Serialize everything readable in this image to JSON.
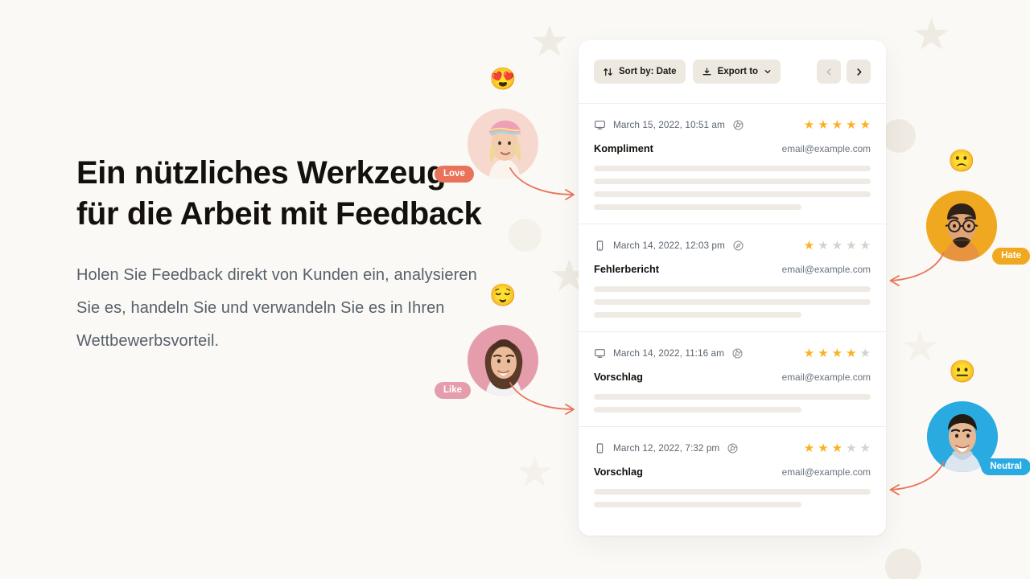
{
  "page": {
    "background_color": "#FBF9F5",
    "accent_color": "#FDB022",
    "arrow_color": "#E8735A"
  },
  "hero": {
    "heading": "Ein nützliches Werkzeug für die Arbeit mit Feedback",
    "paragraph": "Holen Sie Feedback direkt von Kunden ein, analysieren Sie es, handeln Sie und verwandeln Sie es in Ihren Wettbewerbsvorteil."
  },
  "card": {
    "toolbar": {
      "sort_label": "Sort by: Date",
      "sort_icon": "sort-arrows-icon",
      "export_label": "Export to",
      "export_icon": "download-icon",
      "export_chevron_icon": "chevron-down-icon",
      "prev_label": "‹",
      "prev_icon": "chevron-left-icon",
      "next_label": "›",
      "next_icon": "chevron-right-icon"
    },
    "rows": [
      {
        "device_icon": "desktop-icon",
        "date": "March 15, 2022, 10:51 am",
        "browser_icon": "chrome-icon",
        "rating": 5,
        "max_rating": 5,
        "title": "Kompliment",
        "email": "email@example.com",
        "skeleton_widths": [
          "100%",
          "100%",
          "100%",
          "75%"
        ]
      },
      {
        "device_icon": "mobile-icon",
        "date": "March 14, 2022, 12:03 pm",
        "browser_icon": "safari-icon",
        "rating": 1,
        "max_rating": 5,
        "title": "Fehlerbericht",
        "email": "email@example.com",
        "skeleton_widths": [
          "100%",
          "100%",
          "75%"
        ]
      },
      {
        "device_icon": "desktop-icon",
        "date": "March 14, 2022, 11:16 am",
        "browser_icon": "chrome-icon",
        "rating": 4,
        "max_rating": 5,
        "title": "Vorschlag",
        "email": "email@example.com",
        "skeleton_widths": [
          "100%",
          "75%"
        ]
      },
      {
        "device_icon": "mobile-icon",
        "date": "March 12, 2022, 7:32 pm",
        "browser_icon": "chrome-icon",
        "rating": 3,
        "max_rating": 5,
        "title": "Vorschlag",
        "email": "email@example.com",
        "skeleton_widths": [
          "100%",
          "75%"
        ]
      }
    ]
  },
  "reaction_avatars": [
    {
      "name": "love",
      "badge_label": "Love",
      "badge_color": "#E8735A",
      "disc_color": "#F6D8CE",
      "emoji": "😍",
      "emoji_name": "smiling-face-with-heart-eyes",
      "badge_side": "left"
    },
    {
      "name": "hate",
      "badge_label": "Hate",
      "badge_color": "#EFA820",
      "disc_color": "#EFA820",
      "emoji": "🙁",
      "emoji_name": "slightly-frowning-face",
      "badge_side": "right"
    },
    {
      "name": "like",
      "badge_label": "Like",
      "badge_color": "#E59DAC",
      "disc_color": "#E59DAC",
      "emoji": "😌",
      "emoji_name": "relieved-face",
      "badge_side": "left"
    },
    {
      "name": "neutral",
      "badge_label": "Neutral",
      "badge_color": "#29ABE2",
      "disc_color": "#29ABE2",
      "emoji": "😐",
      "emoji_name": "neutral-face",
      "badge_side": "right"
    }
  ]
}
